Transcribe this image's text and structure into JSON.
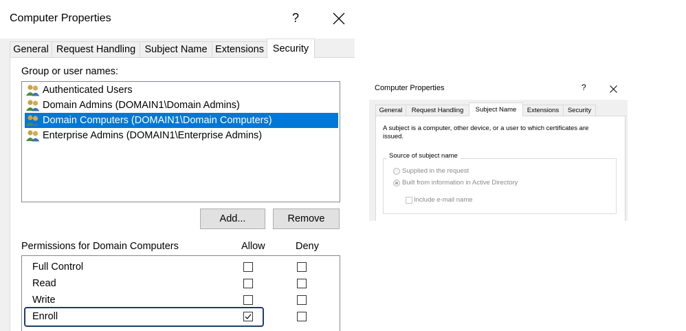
{
  "left_dialog": {
    "title": "Computer Properties",
    "help": "?",
    "tabs": [
      {
        "label": "General"
      },
      {
        "label": "Request Handling"
      },
      {
        "label": "Subject Name"
      },
      {
        "label": "Extensions"
      },
      {
        "label": "Security",
        "active": true
      }
    ],
    "group_label": "Group or user names:",
    "users": [
      {
        "name": "Authenticated Users",
        "icon": "users-icon"
      },
      {
        "name": "Domain Admins (DOMAIN1\\Domain Admins)",
        "icon": "users-icon"
      },
      {
        "name": "Domain Computers (DOMAIN1\\Domain Computers)",
        "icon": "users-icon",
        "selected": true
      },
      {
        "name": "Enterprise Admins (DOMAIN1\\Enterprise Admins)",
        "icon": "users-icon"
      }
    ],
    "add_button": "Add...",
    "remove_button": "Remove",
    "permissions_label": "Permissions for Domain Computers",
    "allow_label": "Allow",
    "deny_label": "Deny",
    "permissions": [
      {
        "name": "Full Control",
        "allow": false,
        "deny": false
      },
      {
        "name": "Read",
        "allow": false,
        "deny": false
      },
      {
        "name": "Write",
        "allow": false,
        "deny": false
      },
      {
        "name": "Enroll",
        "allow": true,
        "deny": false,
        "highlighted": true
      }
    ],
    "selection_color": "#0078d7",
    "highlight_color": "#1f3a6e"
  },
  "right_dialog": {
    "title": "Computer Properties",
    "help": "?",
    "tabs": [
      {
        "label": "General"
      },
      {
        "label": "Request Handling"
      },
      {
        "label": "Subject Name",
        "active": true
      },
      {
        "label": "Extensions"
      },
      {
        "label": "Security"
      }
    ],
    "description": "A subject is a computer, other device, or a user to which certificates are issued.",
    "source_group": "Source of subject name",
    "options": [
      {
        "label": "Supplied in the request",
        "selected": false,
        "enabled": false
      },
      {
        "label": "Built from information in Active Directory",
        "selected": true,
        "enabled": false
      }
    ],
    "include_email": {
      "label": "Include e-mail name",
      "checked": false,
      "enabled": false
    }
  }
}
